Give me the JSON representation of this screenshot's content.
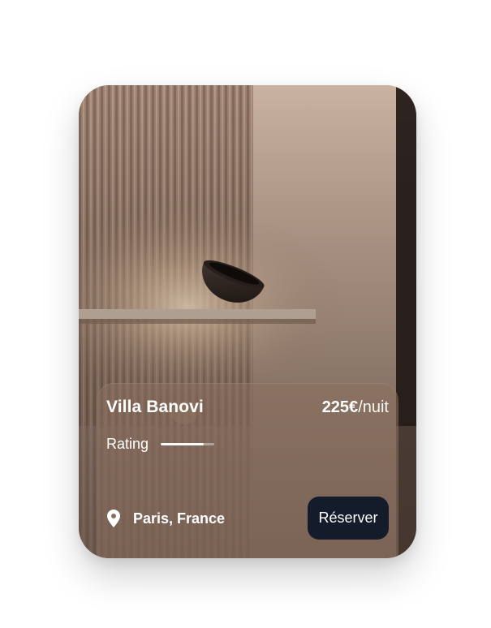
{
  "card": {
    "image_alt": "Interior with a bowl lamp on a lit wooden shelf",
    "title": "Villa Banovi",
    "price": {
      "amount": "225€",
      "unit": "/nuit"
    },
    "rating": {
      "label": "Rating",
      "value_fraction": 0.8
    },
    "location": {
      "icon": "map-pin-icon",
      "text": "Paris, France"
    },
    "reserve_button": {
      "label": "Réserver"
    }
  },
  "colors": {
    "button_bg": "#141b2b",
    "text": "#ffffff"
  }
}
